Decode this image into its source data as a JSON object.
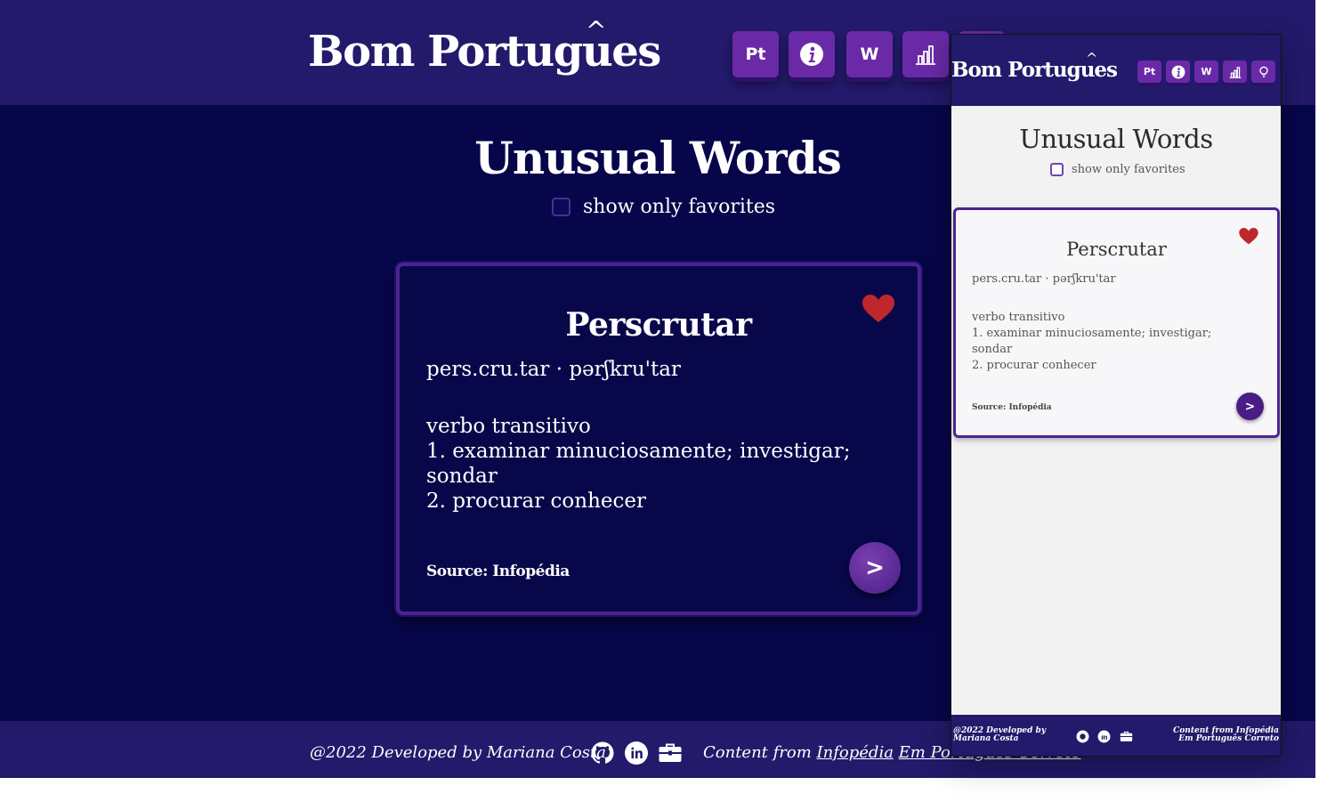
{
  "header": {
    "logo": "Bom Portugues",
    "logo_accent": "^",
    "nav": [
      {
        "label": "Pt",
        "icon": "pt-text-icon"
      },
      {
        "label": "",
        "icon": "info-icon"
      },
      {
        "label": "W",
        "icon": "w-text-icon"
      },
      {
        "label": "",
        "icon": "bar-chart-icon"
      },
      {
        "label": "",
        "icon": "lightbulb-icon"
      }
    ]
  },
  "page": {
    "title": "Unusual Words",
    "favorites_toggle_label": "show only favorites"
  },
  "card": {
    "word": "Perscrutar",
    "pronunciation": "pers.cru.tar · pərʃkru'tar",
    "grammar": "verbo transitivo",
    "definitions": [
      "1. examinar minuciosamente; investigar; sondar",
      "2. procurar conhecer"
    ],
    "source": "Source: Infopédia",
    "next_label": ">",
    "favorited": true
  },
  "footer": {
    "credit": "@2022 Developed by Mariana Costa",
    "content_prefix": "Content from",
    "links": [
      "Infopédia",
      "Em Português Correto"
    ],
    "icons": [
      "github-icon",
      "linkedin-icon",
      "briefcase-icon"
    ]
  },
  "mobile_preview": {
    "footer_credit": "@2022 Developed by Mariana Costa",
    "footer_content": "Content from Infopédia Em Português Correto"
  },
  "colors": {
    "background": "#07064a",
    "header": "#231a6b",
    "accent": "#6a2aa8",
    "heart": "#c0272d"
  }
}
